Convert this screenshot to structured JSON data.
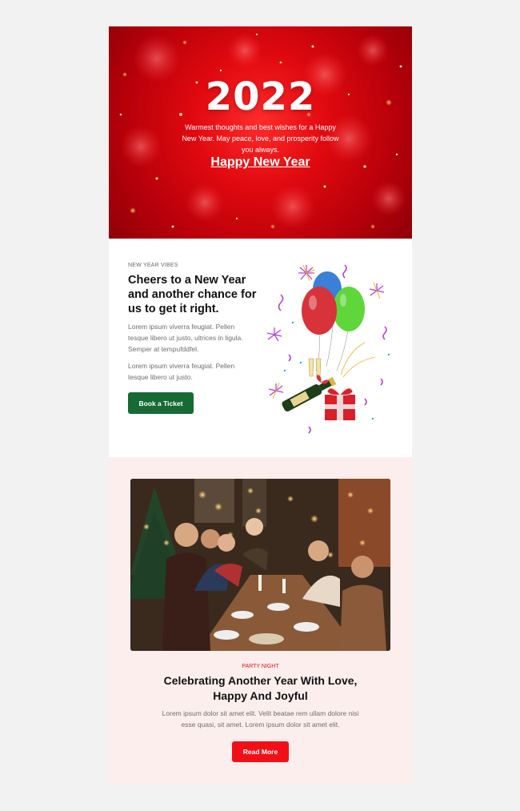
{
  "hero": {
    "year": "2022",
    "message": "Warmest thoughts and best wishes for a Happy New Year. May peace, love, and prosperity follow you always.",
    "link_label": "Happy New Year"
  },
  "vibes": {
    "eyebrow": "NEW YEAR VIBES",
    "heading": "Cheers to a New Year and another chance for us to get it right.",
    "paragraph_1": "Lorem ipsum viverra feugiat. Pellen tesque libero ut justo, ultrices in ligula. Semper at tempufddfel.",
    "paragraph_2": "Lorem ipsum viverra feugiat. Pellen tesque libero ut justo.",
    "button_label": "Book a Ticket",
    "illustration_icon": "balloons-champagne-gift-icon"
  },
  "party": {
    "photo_icon": "party-selfie-photo",
    "eyebrow": "PARTY NIGHT",
    "heading": "Celebrating Another Year With Love, Happy And Joyful",
    "text": "Lorem ipsum dolor sit amet elit. Velit beatae rem ullam dolore nisi esse quasi, sit amet. Lorem ipsum dolor sit amet elit.",
    "button_label": "Read More"
  },
  "colors": {
    "page_background": "#f2f2f2",
    "hero_red": "#e0090f",
    "ticket_button": "#176a34",
    "more_button": "#f21018",
    "party_background": "#fdeeee",
    "party_eyebrow": "#e0121e"
  }
}
